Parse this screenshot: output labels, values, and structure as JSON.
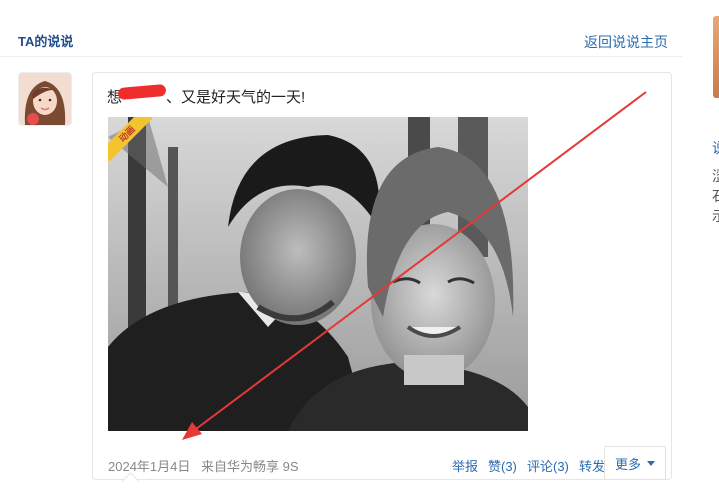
{
  "header": {
    "title": "TA的说说",
    "back_link": "返回说说主页"
  },
  "post": {
    "text_prefix": "想",
    "text_main": "、又是好天气的一天!",
    "gif_badge": "动画",
    "date": "2024年1月4日",
    "source": "来自华为畅享 9S",
    "actions": {
      "report": "举报",
      "like": "赞(3)",
      "comment": "评论(3)",
      "forward": "转发",
      "more": "更多"
    }
  },
  "side": {
    "chars": [
      "说",
      "涩",
      "石",
      "示"
    ]
  },
  "colors": {
    "link": "#2b6cb0",
    "title": "#1f4e8c",
    "annotation_arrow": "#e53935"
  }
}
